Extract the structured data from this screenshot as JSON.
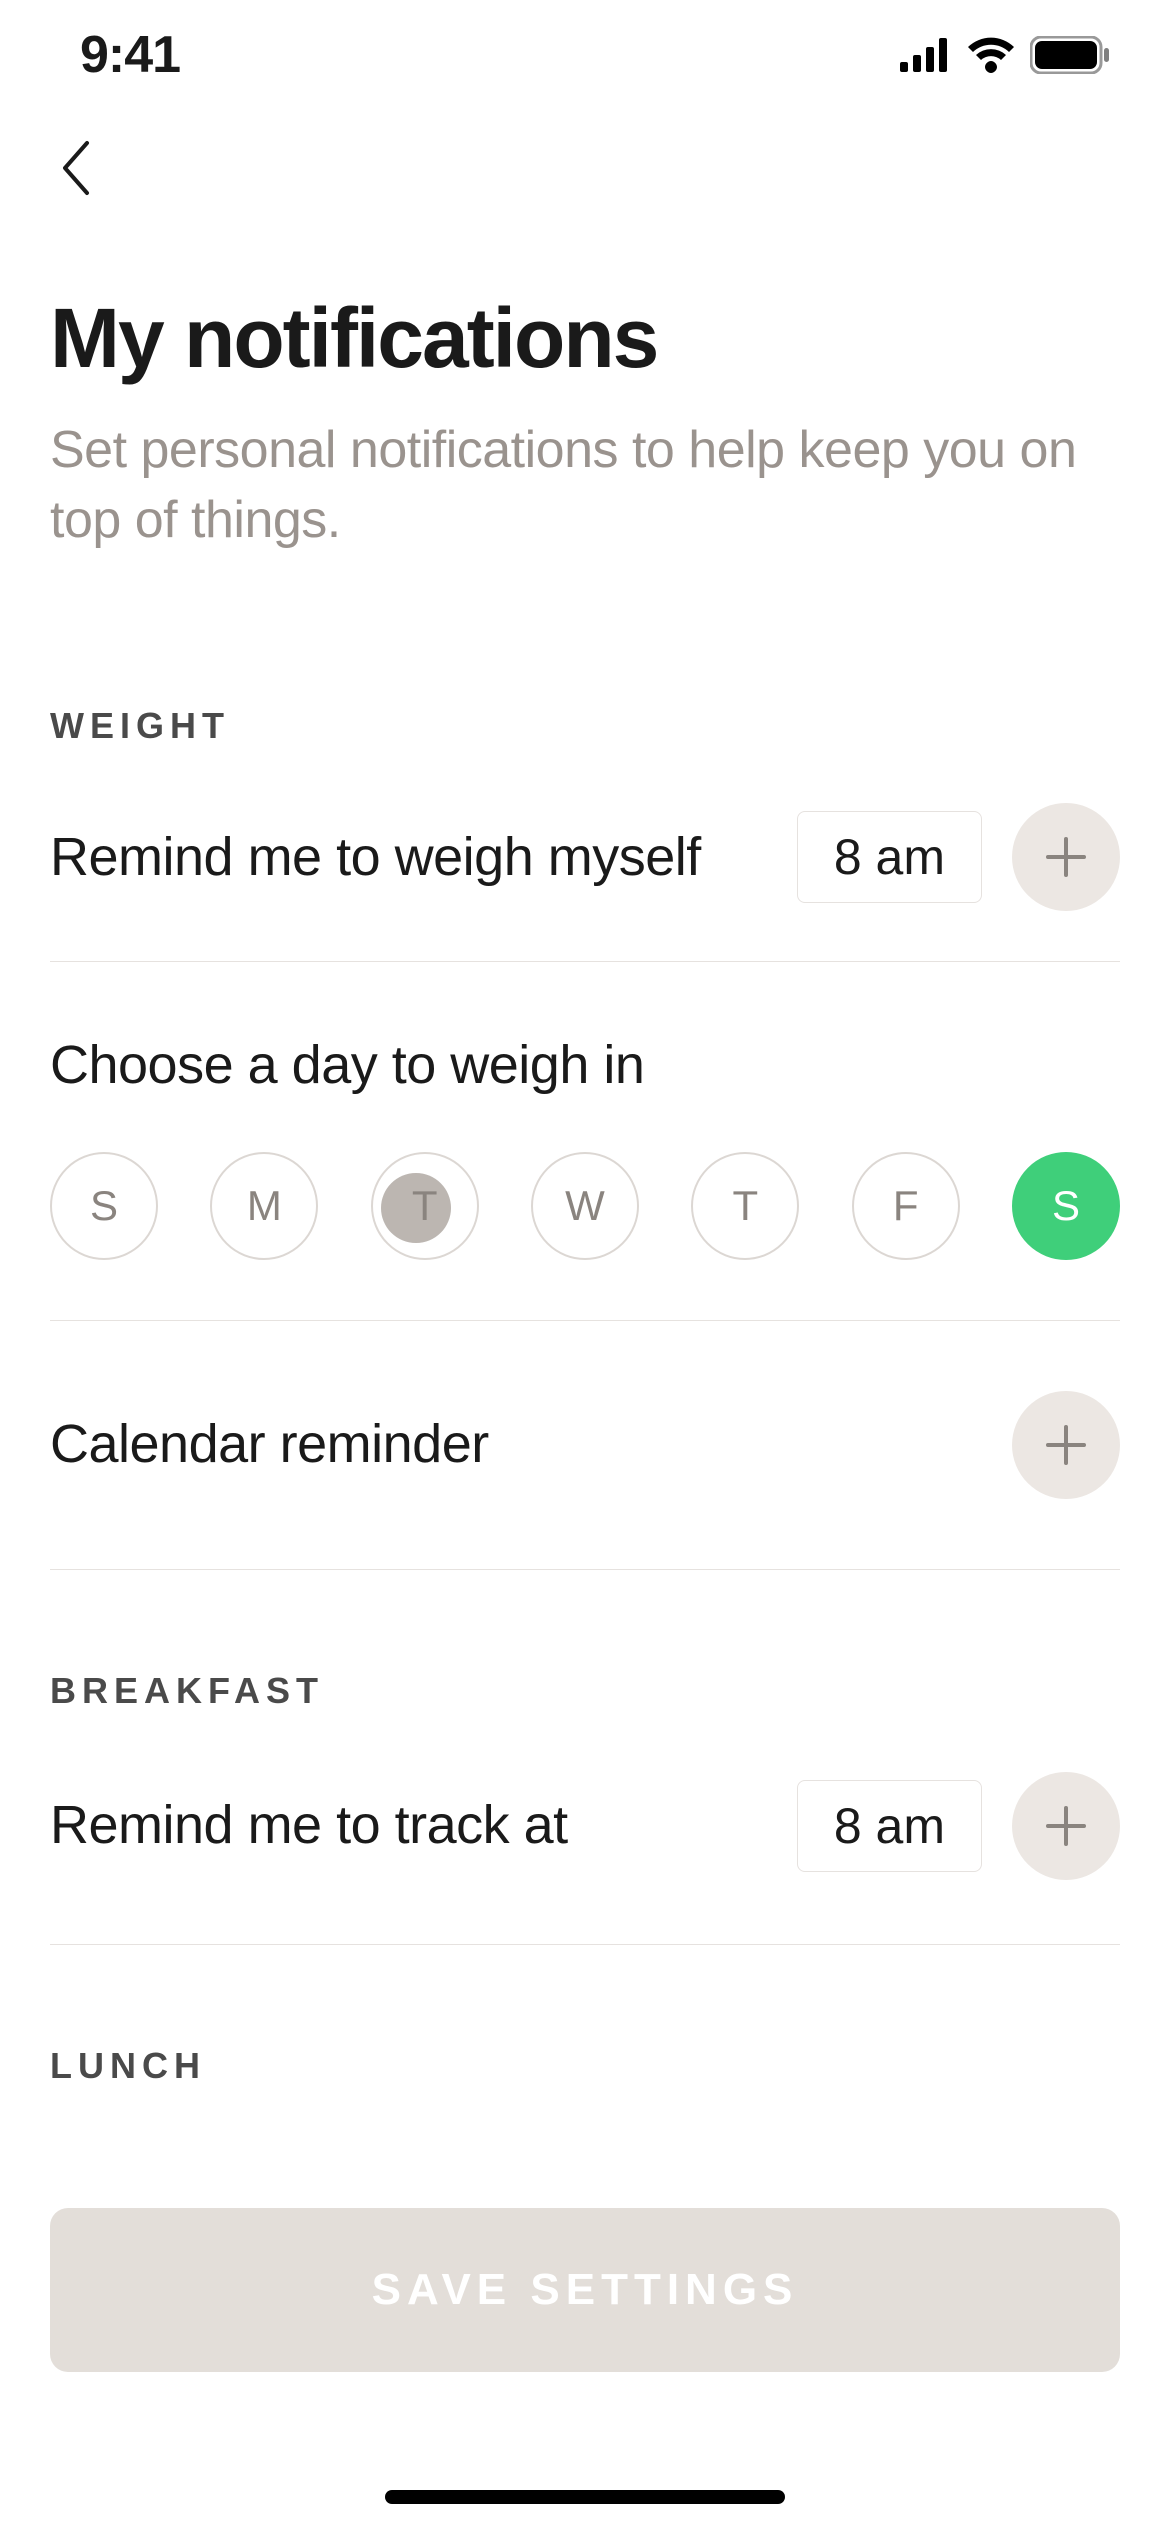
{
  "statusbar": {
    "time": "9:41"
  },
  "page": {
    "title": "My notifications",
    "subtitle": "Set personal notifications to help keep you on top of things."
  },
  "sections": {
    "weight": {
      "label": "WEIGHT",
      "reminder_label": "Remind me to weigh myself",
      "time": "8 am",
      "day_picker_label": "Choose a day to weigh in",
      "days": [
        {
          "abbr": "S",
          "selected": false
        },
        {
          "abbr": "M",
          "selected": false
        },
        {
          "abbr": "T",
          "selected": false
        },
        {
          "abbr": "W",
          "selected": false
        },
        {
          "abbr": "T",
          "selected": false
        },
        {
          "abbr": "F",
          "selected": false
        },
        {
          "abbr": "S",
          "selected": true
        }
      ],
      "calendar_label": "Calendar reminder"
    },
    "breakfast": {
      "label": "BREAKFAST",
      "reminder_label": "Remind me to track at",
      "time": "8 am"
    },
    "lunch": {
      "label": "LUNCH"
    }
  },
  "footer": {
    "save_label": "SAVE SETTINGS"
  }
}
